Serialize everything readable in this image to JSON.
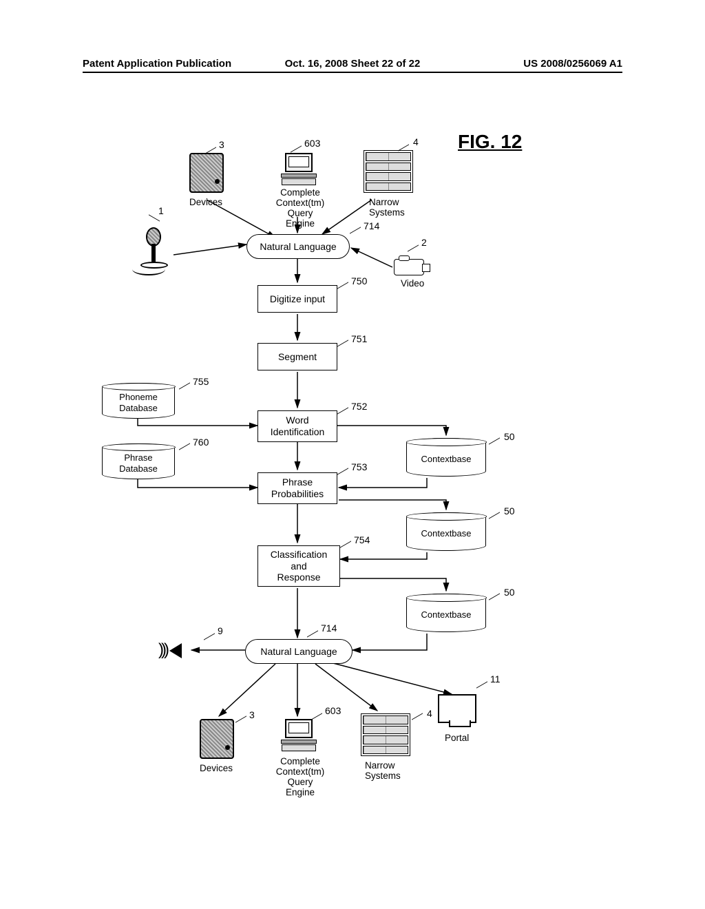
{
  "header": {
    "left": "Patent Application Publication",
    "mid": "Oct. 16, 2008  Sheet 22 of 22",
    "right": "US 2008/0256069 A1"
  },
  "figure_title": "FIG. 12",
  "labels": {
    "devices_top": "Devices",
    "query_engine": "Complete\nContext(tm)\nQuery Engine",
    "narrow_systems": "Narrow\nSystems",
    "video": "Video",
    "natural_language": "Natural Language",
    "digitize": "Digitize input",
    "segment": "Segment",
    "word_id": "Word\nIdentification",
    "phrase_prob": "Phrase\nProbabilities",
    "class_response": "Classification\nand\nResponse",
    "phoneme_db": "Phoneme\nDatabase",
    "phrase_db": "Phrase\nDatabase",
    "contextbase": "Contextbase",
    "portal": "Portal",
    "devices_bottom": "Devices"
  },
  "refs": {
    "r1": "1",
    "r2": "2",
    "r3": "3",
    "r4": "4",
    "r9": "9",
    "r11": "11",
    "r50": "50",
    "r603": "603",
    "r714": "714",
    "r750": "750",
    "r751": "751",
    "r752": "752",
    "r753": "753",
    "r754": "754",
    "r755": "755",
    "r760": "760"
  }
}
